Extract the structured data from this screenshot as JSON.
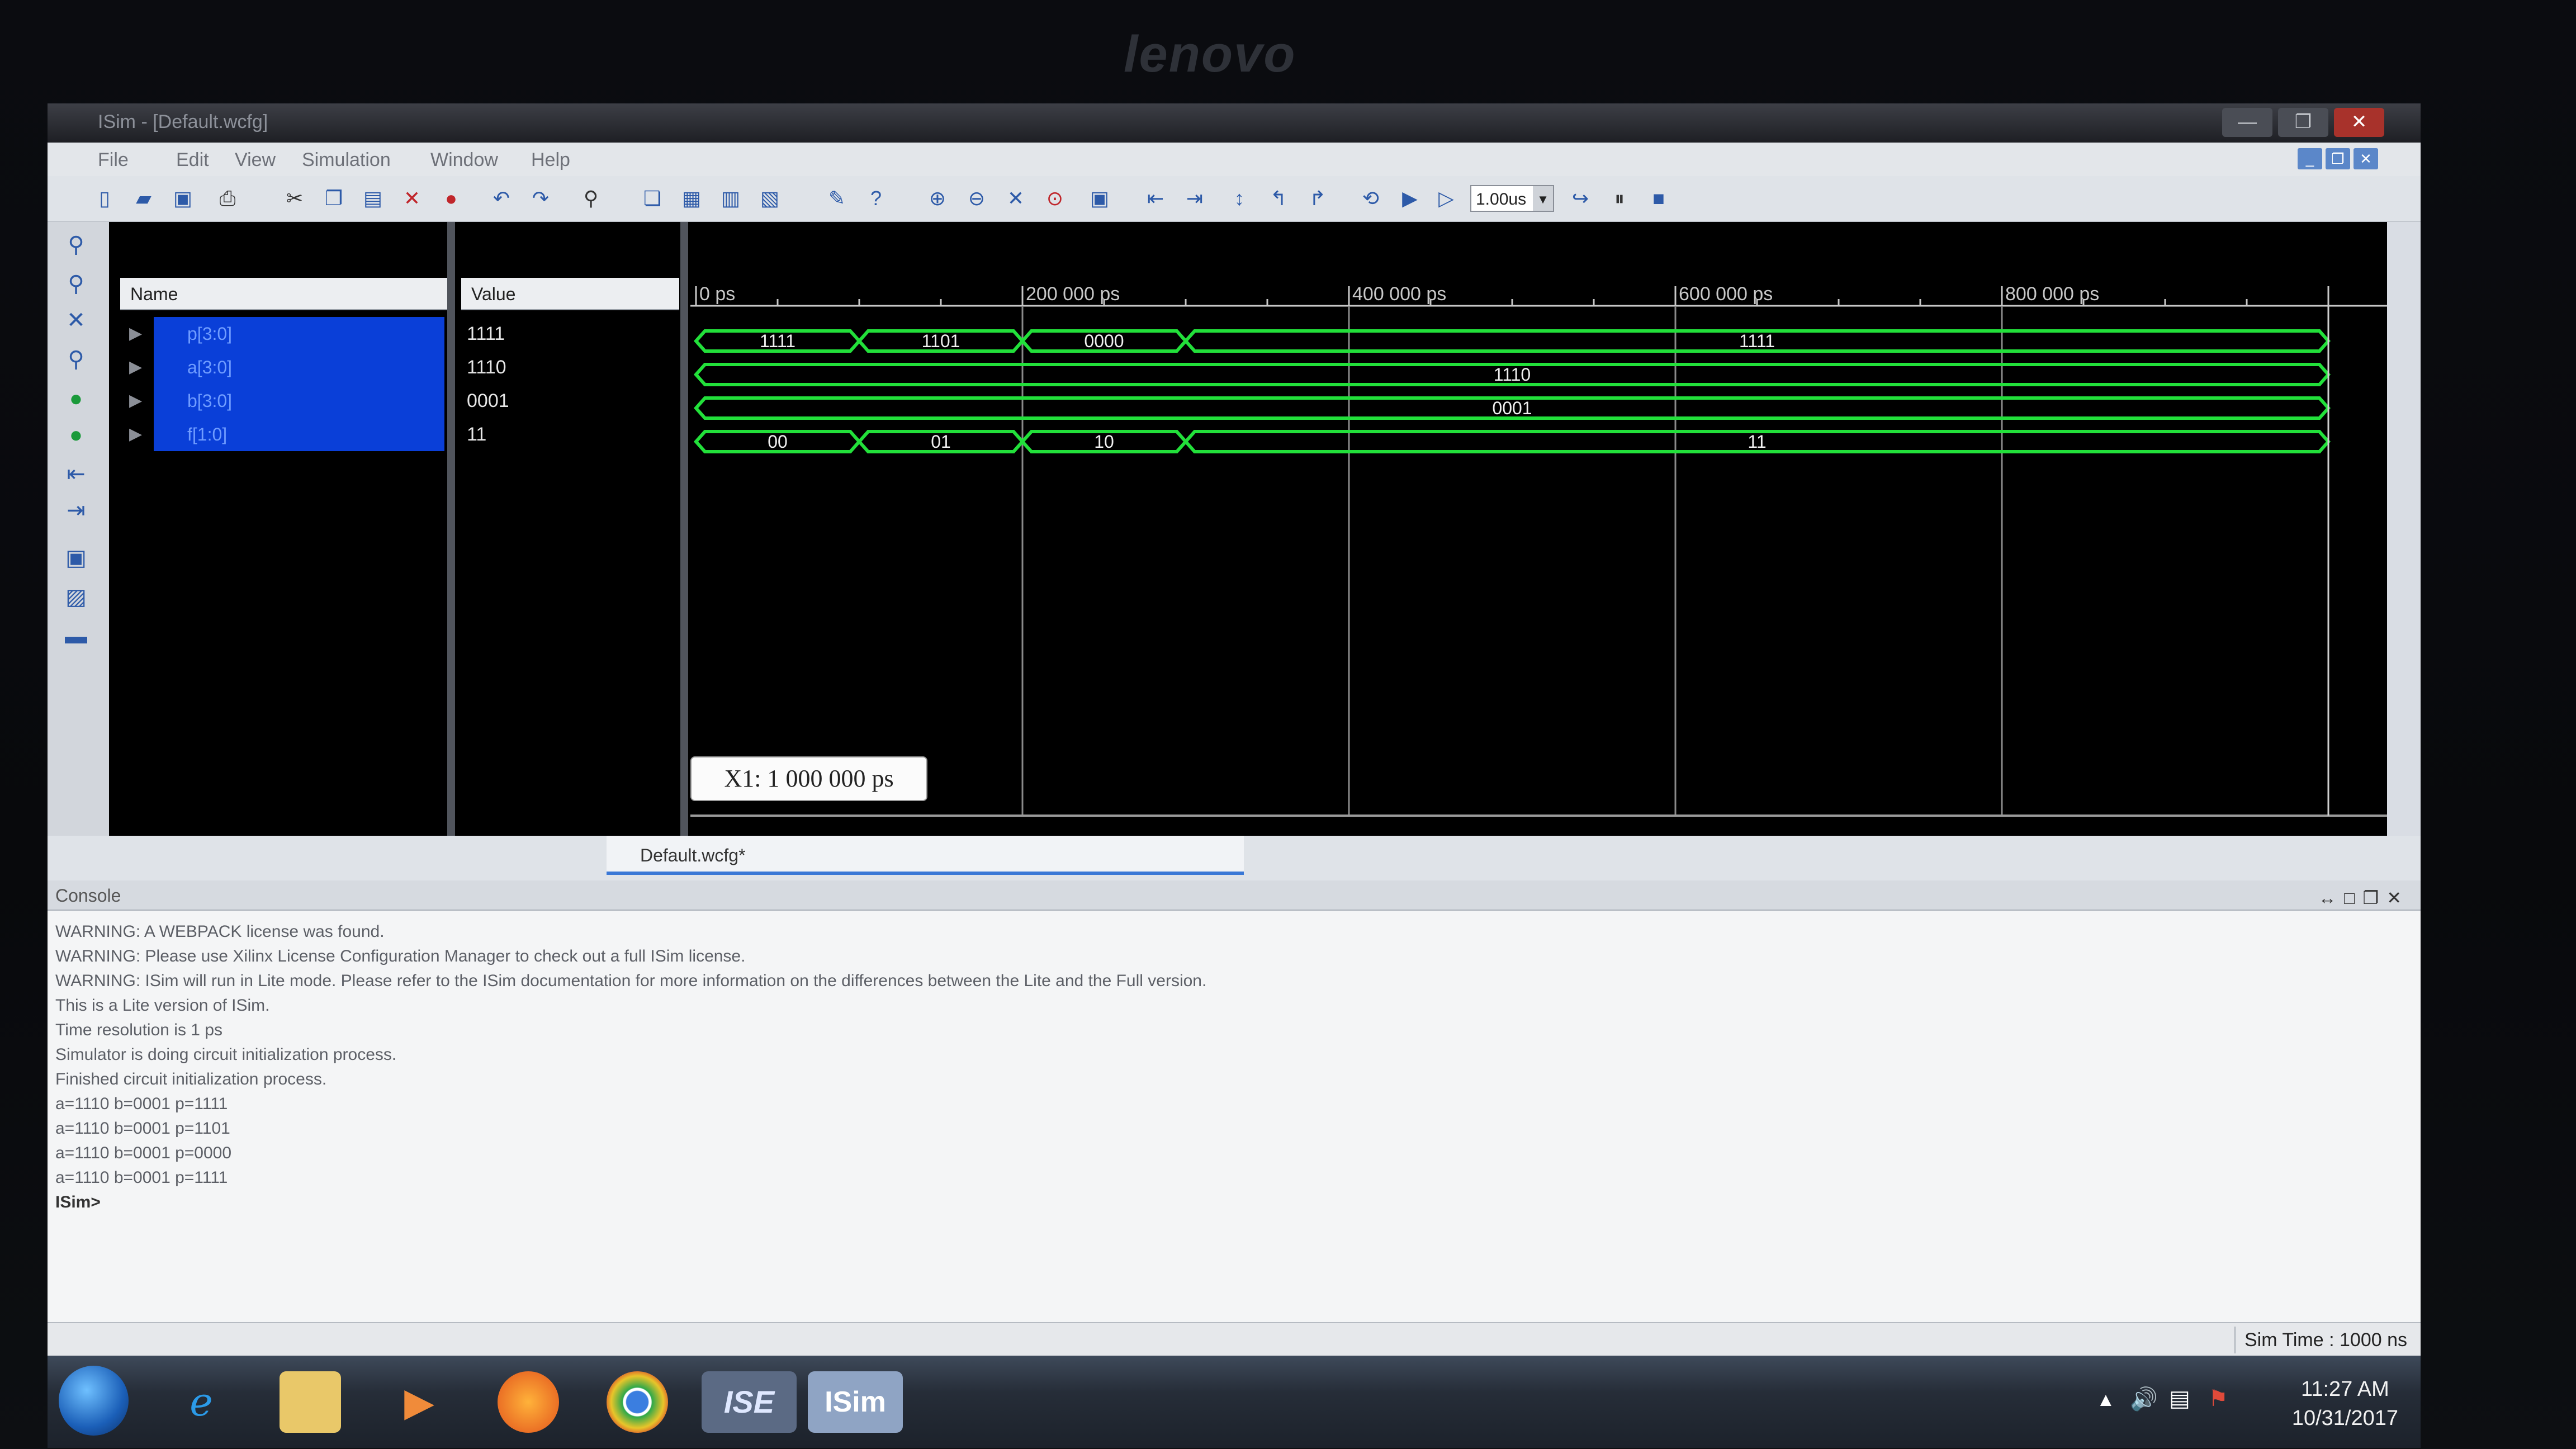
{
  "monitor": {
    "brand": "lenovo"
  },
  "window": {
    "title": "ISim - [Default.wcfg]",
    "controls": [
      "—",
      "❐",
      "✕"
    ]
  },
  "menu": {
    "items": [
      "File",
      "Edit",
      "View",
      "Simulation",
      "Window",
      "Help"
    ]
  },
  "toolbar": {
    "zoom_value": "1.00us"
  },
  "wave": {
    "headers": {
      "name": "Name",
      "value": "Value"
    },
    "signals": [
      {
        "name": "p[3:0]",
        "value": "1111"
      },
      {
        "name": "a[3:0]",
        "value": "1110"
      },
      {
        "name": "b[3:0]",
        "value": "0001"
      },
      {
        "name": "f[1:0]",
        "value": "11"
      }
    ],
    "ticks": [
      "0 ps",
      "200 000 ps",
      "400 000 ps",
      "600 000 ps",
      "800 000 ps"
    ],
    "cursor_tooltip": "X1: 1 000 000 ps",
    "lanes": [
      {
        "segments": [
          {
            "start": 0,
            "end": 100000,
            "label": "1111"
          },
          {
            "start": 100000,
            "end": 200000,
            "label": "1101"
          },
          {
            "start": 200000,
            "end": 300000,
            "label": "0000"
          },
          {
            "start": 300000,
            "end": 1000000,
            "label": "1111"
          }
        ]
      },
      {
        "segments": [
          {
            "start": 0,
            "end": 1000000,
            "label": "1110"
          }
        ]
      },
      {
        "segments": [
          {
            "start": 0,
            "end": 1000000,
            "label": "0001"
          }
        ]
      },
      {
        "segments": [
          {
            "start": 0,
            "end": 100000,
            "label": "00"
          },
          {
            "start": 100000,
            "end": 200000,
            "label": "01"
          },
          {
            "start": 200000,
            "end": 300000,
            "label": "10"
          },
          {
            "start": 300000,
            "end": 1000000,
            "label": "11"
          }
        ]
      }
    ]
  },
  "tabs": {
    "active": "Default.wcfg*"
  },
  "console": {
    "title": "Console",
    "lines": [
      "WARNING: A WEBPACK license was found.",
      "WARNING: Please use Xilinx License Configuration Manager to check out a full ISim license.",
      "WARNING: ISim will run in Lite mode. Please refer to the ISim documentation for more information on the differences between the Lite and the Full version.",
      "This is a Lite version of ISim.",
      "Time resolution is 1 ps",
      "Simulator is doing circuit initialization process.",
      "Finished circuit initialization process.",
      "a=1110 b=0001 p=1111",
      "a=1110 b=0001 p=1101",
      "a=1110 b=0001 p=0000",
      "a=1110 b=0001 p=1111"
    ],
    "prompt": "ISim>"
  },
  "status": {
    "sim_time": "Sim Time : 1000 ns"
  },
  "taskbar": {
    "apps": [
      "internet-explorer",
      "file-explorer",
      "media-player",
      "firefox",
      "chrome",
      "ise",
      "isim"
    ],
    "ise_label": "ISE",
    "isim_label": "ISim",
    "time": "11:27 AM",
    "date": "10/31/2017"
  },
  "colors": {
    "wave": "#22e03a",
    "selection": "#0a3fd8",
    "cursor": "#ffffff"
  }
}
